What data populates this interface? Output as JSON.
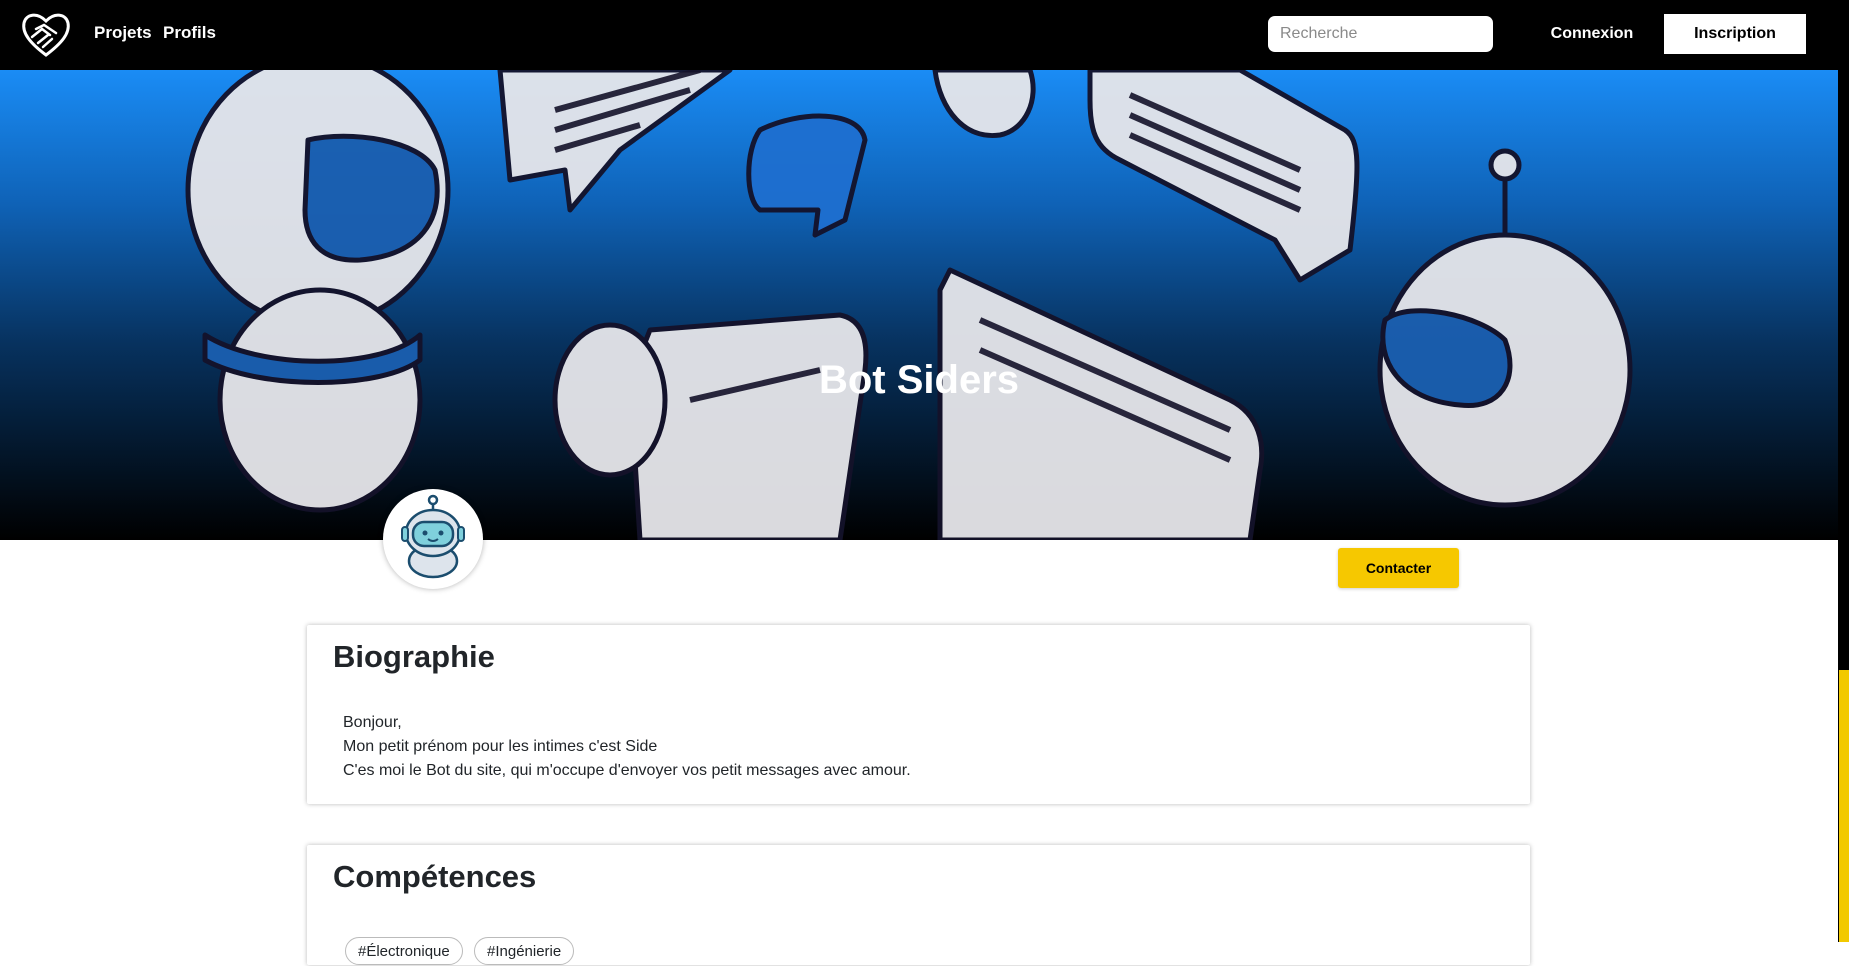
{
  "nav": {
    "logo_icon": "handshake-heart-icon",
    "links": [
      "Projets",
      "Profils"
    ],
    "search_placeholder": "Recherche",
    "login_label": "Connexion",
    "signup_label": "Inscription"
  },
  "profile": {
    "name": "Bot Siders",
    "avatar_icon": "robot-avatar-icon",
    "contact_label": "Contacter"
  },
  "biography": {
    "title": "Biographie",
    "lines": [
      "Bonjour,",
      "Mon petit prénom pour les intimes c'est Side",
      "C'es moi le Bot du site, qui m'occupe d'envoyer vos petit messages avec amour."
    ]
  },
  "skills": {
    "title": "Compétences",
    "tags": [
      "#Électronique",
      "#Ingénierie"
    ]
  },
  "colors": {
    "navbar": "#000000",
    "banner_top": "#1a8cf5",
    "banner_bottom": "#000000",
    "accent": "#f6c800"
  }
}
